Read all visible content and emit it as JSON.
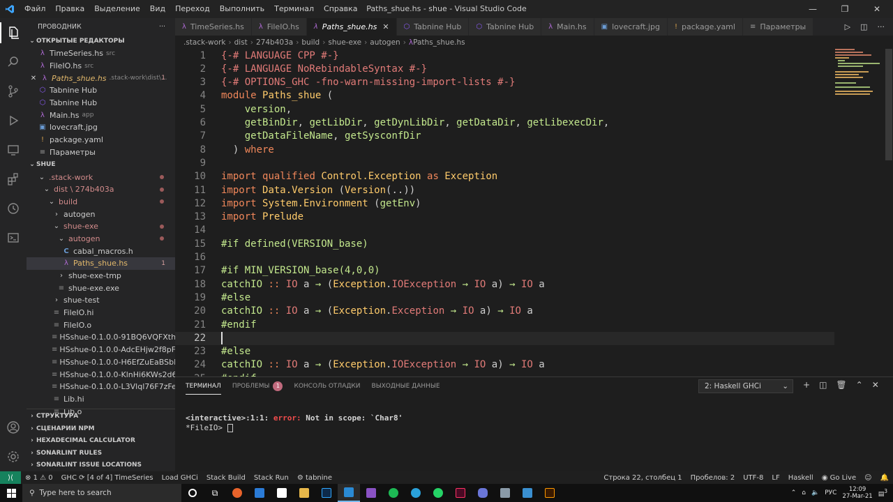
{
  "titlebar": {
    "menu": [
      "Файл",
      "Правка",
      "Выделение",
      "Вид",
      "Переход",
      "Выполнить",
      "Терминал",
      "Справка"
    ],
    "title": "Paths_shue.hs - shue - Visual Studio Code"
  },
  "sidebar": {
    "header": "ПРОВОДНИК",
    "open_editors_title": "ОТКРЫТЫЕ РЕДАКТОРЫ",
    "open_editors": [
      {
        "label": "TimeSeries.hs",
        "sub": "src",
        "icon": "haskell-icon"
      },
      {
        "label": "FileIO.hs",
        "sub": "src",
        "icon": "haskell-icon"
      },
      {
        "label": "Paths_shue.hs",
        "sub": ".stack-work\\dist\\...",
        "badge": "1",
        "icon": "haskell-icon"
      },
      {
        "label": "Tabnine Hub",
        "sub": "",
        "icon": "tabnine-icon"
      },
      {
        "label": "Tabnine Hub",
        "sub": "",
        "icon": "tabnine-icon"
      },
      {
        "label": "Main.hs",
        "sub": "app",
        "icon": "haskell-icon"
      },
      {
        "label": "lovecraft.jpg",
        "sub": "",
        "icon": "image-icon"
      },
      {
        "label": "package.yaml",
        "sub": "",
        "icon": "yaml-icon"
      },
      {
        "label": "Параметры",
        "sub": "",
        "icon": "settings-file-icon"
      }
    ],
    "workspace_title": "SHUE",
    "tree": [
      {
        "label": ".stack-work",
        "depth": 1,
        "type": "folder-open",
        "dot": true
      },
      {
        "label": "dist \\ 274b403a",
        "depth": 2,
        "type": "folder-open",
        "dot": true
      },
      {
        "label": "build",
        "depth": 3,
        "type": "folder-open",
        "dot": true
      },
      {
        "label": "autogen",
        "depth": 4,
        "type": "folder-closed"
      },
      {
        "label": "shue-exe",
        "depth": 4,
        "type": "folder-open",
        "dot": true
      },
      {
        "label": "autogen",
        "depth": 5,
        "type": "folder-open",
        "dot": true
      },
      {
        "label": "cabal_macros.h",
        "depth": 6,
        "type": "c-file"
      },
      {
        "label": "Paths_shue.hs",
        "depth": 6,
        "type": "hs-file",
        "badge": "1",
        "selected": true
      },
      {
        "label": "shue-exe-tmp",
        "depth": 5,
        "type": "folder-closed"
      },
      {
        "label": "shue-exe.exe",
        "depth": 5,
        "type": "file"
      },
      {
        "label": "shue-test",
        "depth": 4,
        "type": "folder-closed"
      },
      {
        "label": "FileIO.hi",
        "depth": 4,
        "type": "file"
      },
      {
        "label": "FileIO.o",
        "depth": 4,
        "type": "file"
      },
      {
        "label": "HSshue-0.1.0.0-91BQ6VQFXth4xN...",
        "depth": 4,
        "type": "file"
      },
      {
        "label": "HSshue-0.1.0.0-AdcEHjw2f8pFao0...",
        "depth": 4,
        "type": "file"
      },
      {
        "label": "HSshue-0.1.0.0-H6EfZuEaBSbKSU...",
        "depth": 4,
        "type": "file"
      },
      {
        "label": "HSshue-0.1.0.0-KlnHi6KWs2d6zW...",
        "depth": 4,
        "type": "file"
      },
      {
        "label": "HSshue-0.1.0.0-L3Vlql76F7zFeOM...",
        "depth": 4,
        "type": "file"
      },
      {
        "label": "Lib.hi",
        "depth": 4,
        "type": "file"
      },
      {
        "label": "Lib.o",
        "depth": 4,
        "type": "file"
      }
    ],
    "bottom_sections": [
      "СТРУКТУРА",
      "СЦЕНАРИИ NPM",
      "HEXADECIMAL CALCULATOR",
      "SONARLINT RULES",
      "SONARLINT ISSUE LOCATIONS"
    ]
  },
  "tabs": [
    {
      "label": "TimeSeries.hs",
      "icon": "haskell-icon",
      "active": false
    },
    {
      "label": "FileIO.hs",
      "icon": "haskell-icon",
      "active": false
    },
    {
      "label": "Paths_shue.hs",
      "icon": "haskell-icon",
      "active": true
    },
    {
      "label": "Tabnine Hub",
      "icon": "tabnine-icon",
      "active": false
    },
    {
      "label": "Tabnine Hub",
      "icon": "tabnine-icon",
      "active": false
    },
    {
      "label": "Main.hs",
      "icon": "haskell-icon",
      "active": false
    },
    {
      "label": "lovecraft.jpg",
      "icon": "image-icon",
      "active": false
    },
    {
      "label": "package.yaml",
      "icon": "yaml-icon",
      "active": false
    },
    {
      "label": "Параметры",
      "icon": "settings-file-icon",
      "active": false
    }
  ],
  "breadcrumb": [
    ".stack-work",
    "dist",
    "274b403a",
    "build",
    "shue-exe",
    "autogen",
    "Paths_shue.hs"
  ],
  "editor": {
    "lines": [
      [
        [
          "p",
          "{-# LANGUAGE CPP #-}"
        ]
      ],
      [
        [
          "p",
          "{-# LANGUAGE NoRebindableSyntax #-}"
        ]
      ],
      [
        [
          "p",
          "{-# OPTIONS_GHC -fno-warn-missing-import-lists #-}"
        ]
      ],
      [
        [
          "k",
          "module "
        ],
        [
          "c",
          "Paths_shue"
        ],
        [
          "o",
          " ("
        ]
      ],
      [
        [
          "o",
          "    "
        ],
        [
          "v",
          "version"
        ],
        [
          "o",
          ","
        ]
      ],
      [
        [
          "o",
          "    "
        ],
        [
          "v",
          "getBinDir"
        ],
        [
          "o",
          ", "
        ],
        [
          "v",
          "getLibDir"
        ],
        [
          "o",
          ", "
        ],
        [
          "v",
          "getDynLibDir"
        ],
        [
          "o",
          ", "
        ],
        [
          "v",
          "getDataDir"
        ],
        [
          "o",
          ", "
        ],
        [
          "v",
          "getLibexecDir"
        ],
        [
          "o",
          ","
        ]
      ],
      [
        [
          "o",
          "    "
        ],
        [
          "v",
          "getDataFileName"
        ],
        [
          "o",
          ", "
        ],
        [
          "v",
          "getSysconfDir"
        ]
      ],
      [
        [
          "o",
          "  ) "
        ],
        [
          "k",
          "where"
        ]
      ],
      [],
      [
        [
          "k",
          "import "
        ],
        [
          "k",
          "qualified "
        ],
        [
          "c",
          "Control.Exception"
        ],
        [
          "k",
          " as "
        ],
        [
          "c",
          "Exception"
        ]
      ],
      [
        [
          "k",
          "import "
        ],
        [
          "c",
          "Data.Version"
        ],
        [
          "o",
          " ("
        ],
        [
          "c",
          "Version"
        ],
        [
          "o",
          "(..))"
        ]
      ],
      [
        [
          "k",
          "import "
        ],
        [
          "c",
          "System.Environment"
        ],
        [
          "o",
          " ("
        ],
        [
          "v",
          "getEnv"
        ],
        [
          "o",
          ")"
        ]
      ],
      [
        [
          "k",
          "import "
        ],
        [
          "c",
          "Prelude"
        ]
      ],
      [],
      [
        [
          "v",
          "#if defined(VERSION_base)"
        ]
      ],
      [],
      [
        [
          "v",
          "#if MIN_VERSION_base(4,0,0)"
        ]
      ],
      [
        [
          "v",
          "catchIO"
        ],
        [
          "k",
          " :: "
        ],
        [
          "p",
          "IO"
        ],
        [
          "o",
          " a "
        ],
        [
          "v",
          "→"
        ],
        [
          "o",
          " ("
        ],
        [
          "c",
          "Exception"
        ],
        [
          "o",
          "."
        ],
        [
          "p",
          "IOException"
        ],
        [
          "v",
          " → "
        ],
        [
          "p",
          "IO"
        ],
        [
          "o",
          " a) "
        ],
        [
          "v",
          "→"
        ],
        [
          "p",
          " IO"
        ],
        [
          "o",
          " a"
        ]
      ],
      [
        [
          "v",
          "#else"
        ]
      ],
      [
        [
          "v",
          "catchIO"
        ],
        [
          "k",
          " :: "
        ],
        [
          "p",
          "IO"
        ],
        [
          "o",
          " a "
        ],
        [
          "v",
          "→"
        ],
        [
          "o",
          " ("
        ],
        [
          "c",
          "Exception"
        ],
        [
          "o",
          "."
        ],
        [
          "p",
          "Exception"
        ],
        [
          "v",
          " → "
        ],
        [
          "p",
          "IO"
        ],
        [
          "o",
          " a) "
        ],
        [
          "v",
          "→"
        ],
        [
          "p",
          " IO"
        ],
        [
          "o",
          " a"
        ]
      ],
      [
        [
          "v",
          "#endif"
        ]
      ],
      [],
      [
        [
          "v",
          "#else"
        ]
      ],
      [
        [
          "v",
          "catchIO"
        ],
        [
          "k",
          " :: "
        ],
        [
          "p",
          "IO"
        ],
        [
          "o",
          " a "
        ],
        [
          "v",
          "→"
        ],
        [
          "o",
          " ("
        ],
        [
          "c",
          "Exception"
        ],
        [
          "o",
          "."
        ],
        [
          "p",
          "IOException"
        ],
        [
          "v",
          " → "
        ],
        [
          "p",
          "IO"
        ],
        [
          "o",
          " a) "
        ],
        [
          "v",
          "→"
        ],
        [
          "p",
          " IO"
        ],
        [
          "o",
          " a"
        ]
      ],
      [
        [
          "v",
          "#endif"
        ]
      ]
    ]
  },
  "panel": {
    "tabs": [
      {
        "label": "ТЕРМИНАЛ",
        "active": true
      },
      {
        "label": "ПРОБЛЕМЫ",
        "badge": "1"
      },
      {
        "label": "КОНСОЛЬ ОТЛАДКИ"
      },
      {
        "label": "ВЫХОДНЫЕ ДАННЫЕ"
      }
    ],
    "terminal_select": "2: Haskell GHCi",
    "terminal": {
      "prefix": "<interactive>:1:1: ",
      "error_label": "error:",
      "message": " Not in scope: `Char8'",
      "prompt": "*FileIO> "
    }
  },
  "statusbar": {
    "errors": "1",
    "warnings": "0",
    "left": [
      "GHC",
      "[4 of 4] TimeSeries",
      "Load GHCi",
      "Stack Build",
      "Stack Run",
      "tabnine"
    ],
    "right": [
      "Строка 22, столбец 1",
      "Пробелов: 2",
      "UTF-8",
      "LF",
      "Haskell",
      "Go Live"
    ]
  },
  "taskbar": {
    "search_placeholder": "Type here to search",
    "lang": "РУС",
    "time": "12:09",
    "date": "27-Mar-21",
    "notifications": "3"
  },
  "colors": {
    "keyword": "#f0875a",
    "type": "#ffcb6b",
    "value": "#c3e88d",
    "pragma": "#e27b78",
    "accent": "#0e7acc"
  }
}
